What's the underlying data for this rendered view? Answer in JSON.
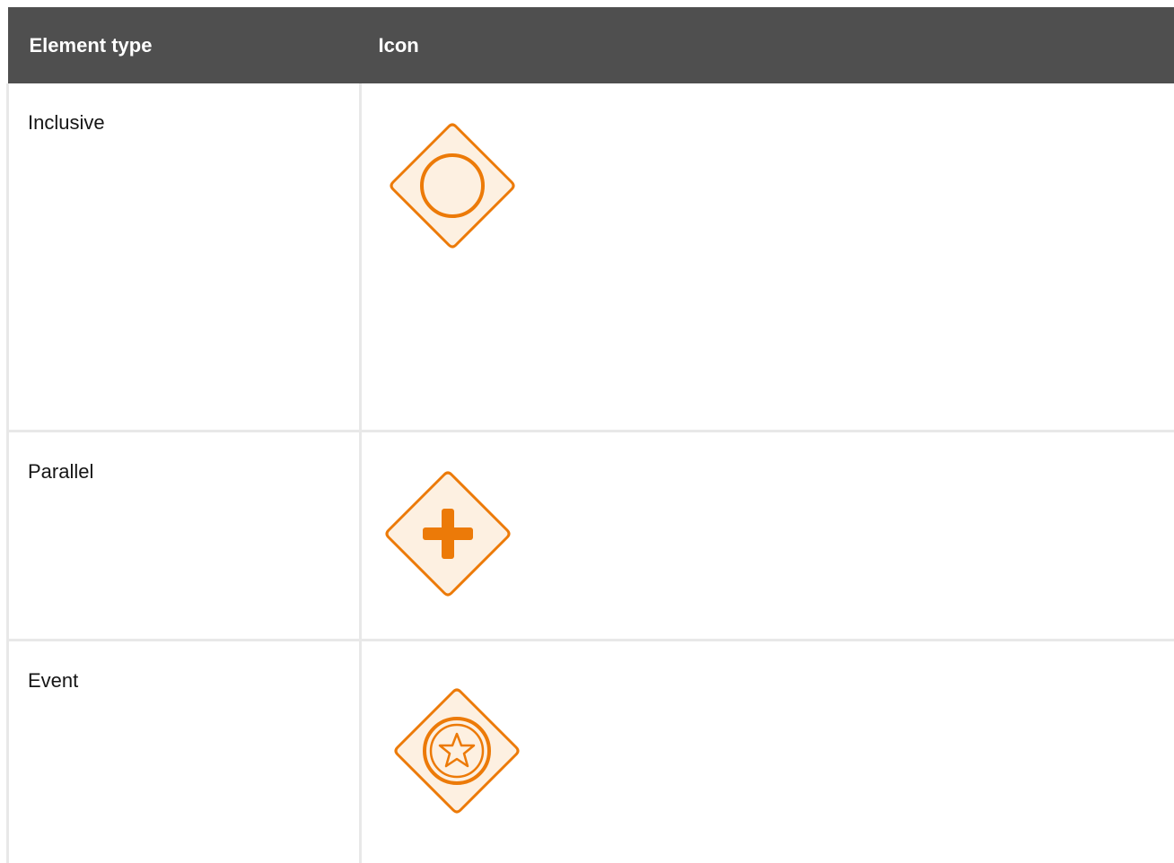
{
  "table": {
    "headers": {
      "element_type": "Element type",
      "icon": "Icon"
    },
    "rows": [
      {
        "element_type": "Inclusive",
        "icon": "inclusive-gateway-icon"
      },
      {
        "element_type": "Parallel",
        "icon": "parallel-gateway-icon"
      },
      {
        "element_type": "Event",
        "icon": "event-gateway-icon"
      }
    ]
  },
  "colors": {
    "header_bg": "#4f4f4f",
    "header_text": "#ffffff",
    "icon_stroke": "#ec7a08",
    "icon_fill": "#fdf0e1",
    "grid_line": "#e8e8e8"
  }
}
